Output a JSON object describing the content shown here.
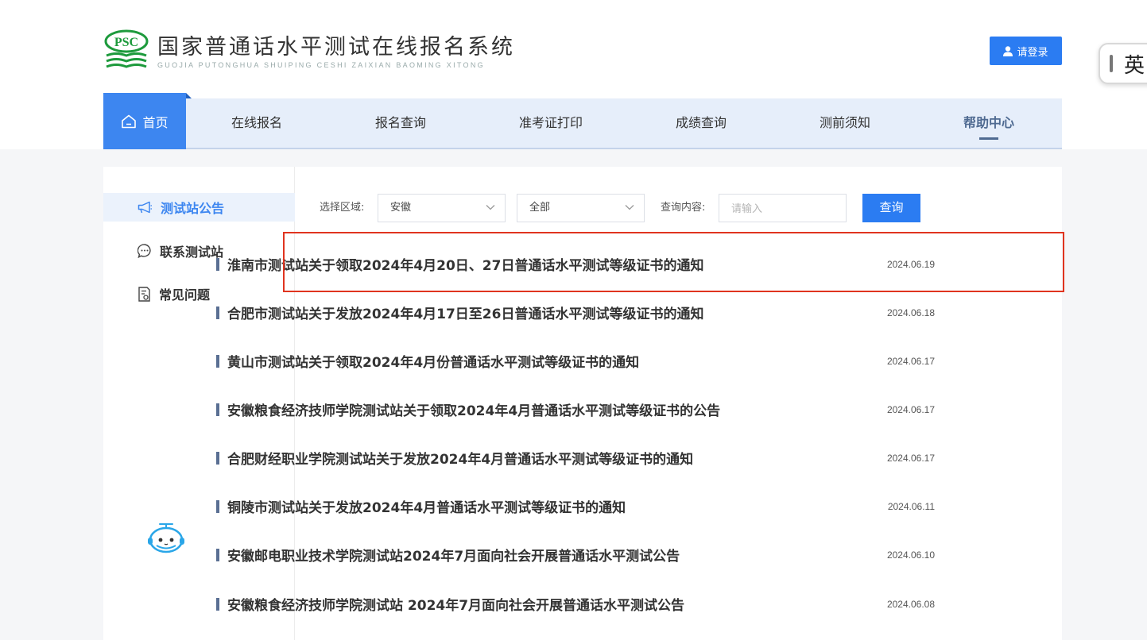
{
  "header": {
    "logo_badge": "PSC",
    "title": "国家普通话水平测试在线报名系统",
    "subtitle": "GUOJIA PUTONGHUA SHUIPING CESHI ZAIXIAN BAOMING XITONG",
    "login_label": "请登录"
  },
  "ime": {
    "char": "英"
  },
  "nav": {
    "home": "首页",
    "items": [
      "在线报名",
      "报名查询",
      "准考证打印",
      "成绩查询",
      "测前须知",
      "帮助中心"
    ],
    "active": "帮助中心"
  },
  "sidebar": {
    "items": [
      {
        "label": "测试站公告",
        "icon": "megaphone-icon",
        "active": true
      },
      {
        "label": "联系测试站",
        "icon": "chat-bubble-icon",
        "active": false
      },
      {
        "label": "常见问题",
        "icon": "document-question-icon",
        "active": false
      }
    ]
  },
  "filters": {
    "region_label": "选择区域:",
    "region_value": "安徽",
    "scope_value": "全部",
    "query_label": "查询内容:",
    "query_placeholder": "请输入",
    "query_value": "",
    "search_label": "查询"
  },
  "notices": [
    {
      "title": "淮南市测试站关于领取2024年4月20日、27日普通话水平测试等级证书的通知",
      "date": "2024.06.19"
    },
    {
      "title": "合肥市测试站关于发放2024年4月17日至26日普通话水平测试等级证书的通知",
      "date": "2024.06.18"
    },
    {
      "title": "黄山市测试站关于领取2024年4月份普通话水平测试等级证书的通知",
      "date": "2024.06.17"
    },
    {
      "title": "安徽粮食经济技师学院测试站关于领取2024年4月普通话水平测试等级证书的公告",
      "date": "2024.06.17"
    },
    {
      "title": "合肥财经职业学院测试站关于发放2024年4月普通话水平测试等级证书的通知",
      "date": "2024.06.17"
    },
    {
      "title": "铜陵市测试站关于发放2024年4月普通话水平测试等级证书的通知",
      "date": "2024.06.11"
    },
    {
      "title": "安徽邮电职业技术学院测试站2024年7月面向社会开展普通话水平测试公告",
      "date": "2024.06.10"
    },
    {
      "title": "安徽粮食经济技师学院测试站 2024年7月面向社会开展普通话水平测试公告",
      "date": "2024.06.08"
    }
  ],
  "colors": {
    "primary": "#2b7cf2",
    "nav_bg": "#e6eefa",
    "active_nav_text": "#4f6a91",
    "highlight_border": "#e0341f",
    "logo_green": "#1d9a3c"
  }
}
